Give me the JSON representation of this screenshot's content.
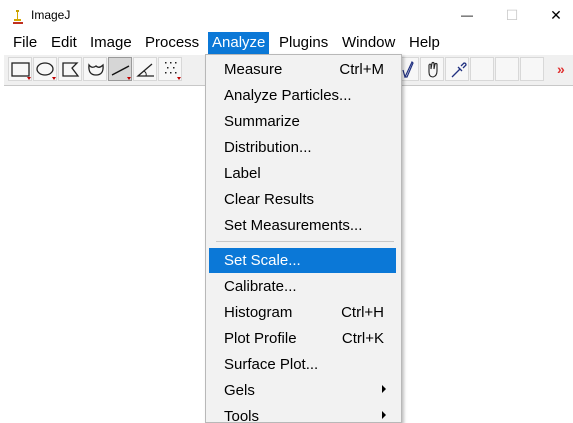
{
  "window": {
    "title": "ImageJ",
    "minimize_icon": "minimize-icon",
    "maximize_icon": "maximize-icon",
    "close_icon": "close-icon",
    "minimize_glyph": "—",
    "maximize_glyph": "☐",
    "close_glyph": "✕"
  },
  "menubar": {
    "items": [
      {
        "label": "File"
      },
      {
        "label": "Edit"
      },
      {
        "label": "Image"
      },
      {
        "label": "Process"
      },
      {
        "label": "Analyze",
        "active": true
      },
      {
        "label": "Plugins"
      },
      {
        "label": "Window"
      },
      {
        "label": "Help"
      }
    ]
  },
  "toolbar": {
    "visible_tool_text": "ev",
    "more_label": "»",
    "tools": [
      "rectangle-selection-icon",
      "oval-selection-icon",
      "polygon-selection-icon",
      "freehand-selection-icon",
      "line-tool-icon",
      "angle-tool-icon",
      "multipoint-tool-icon",
      "dev-tool-icon",
      "pencil-tool-icon",
      "hand-tool-icon",
      "dropper-tool-icon"
    ]
  },
  "colors": {
    "selection": "#0b78d7",
    "menu_bg": "#f2f2f2",
    "toolbar_bg": "#f0f0f0"
  },
  "analyze_menu": {
    "items": [
      {
        "label": "Measure",
        "shortcut": "Ctrl+M"
      },
      {
        "label": "Analyze Particles..."
      },
      {
        "label": "Summarize"
      },
      {
        "label": "Distribution..."
      },
      {
        "label": "Label"
      },
      {
        "label": "Clear Results"
      },
      {
        "label": "Set Measurements..."
      },
      {
        "label": "Set Scale...",
        "selected": true
      },
      {
        "label": "Calibrate..."
      },
      {
        "label": "Histogram",
        "shortcut": "Ctrl+H"
      },
      {
        "label": "Plot Profile",
        "shortcut": "Ctrl+K"
      },
      {
        "label": "Surface Plot..."
      },
      {
        "label": "Gels",
        "submenu": true
      },
      {
        "label": "Tools",
        "submenu": true
      }
    ]
  }
}
